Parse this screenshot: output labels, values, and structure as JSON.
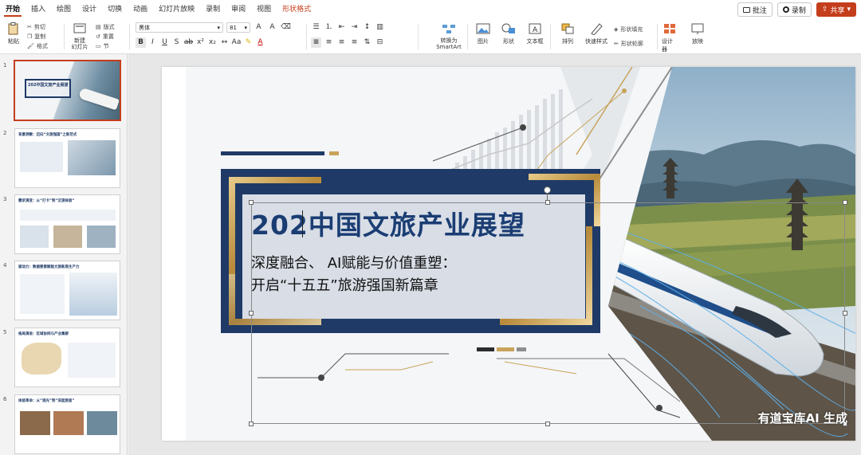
{
  "menu": {
    "tabs": [
      "开始",
      "插入",
      "绘图",
      "设计",
      "切换",
      "动画",
      "幻灯片放映",
      "录制",
      "审阅",
      "视图",
      "形状格式"
    ],
    "comment_label": "批注",
    "record_label": "录制",
    "share_label": "共享"
  },
  "ribbon": {
    "paste": "粘贴",
    "cut": "剪切",
    "copy": "复制",
    "format_painter": "格式",
    "new_slide": "新建\n幻灯片",
    "layout": "版式",
    "reset": "重置",
    "section": "节",
    "font_name": "黑体",
    "font_size": "81",
    "convert_smartart": "转换为\nSmartArt",
    "picture": "图片",
    "shapes": "形状",
    "textbox": "文本框",
    "arrange": "排列",
    "quick_styles": "快速样式",
    "shape_fill": "形状填充",
    "shape_outline": "形状轮廓",
    "design_ideas": "设计器",
    "slide_show": "放映"
  },
  "thumbnails": [
    {
      "num": "1",
      "title": "202中国文旅产业展望",
      "active": true
    },
    {
      "num": "2",
      "title": "背景洞察：迈向“文旅强国”之新范式",
      "active": false
    },
    {
      "num": "3",
      "title": "需求演变：从“打卡”到“沉浸体验”",
      "active": false
    },
    {
      "num": "4",
      "title": "驱动力：数据要素赋能文旅新质生产力",
      "active": false
    },
    {
      "num": "5",
      "title": "格局演进：区域协同与产业集群",
      "active": false
    },
    {
      "num": "6",
      "title": "体验革命：从“观光”到“深度旅居”",
      "active": false
    }
  ],
  "slide": {
    "title": "202中国文旅产业展望",
    "subtitle_line1": "深度融合、 AI赋能与价值重塑：",
    "subtitle_line2": "开启“十五五”旅游强国新篇章",
    "watermark": "有道宝库AI 生成"
  },
  "colors": {
    "accent": "#c43e1c",
    "title_blue": "#1a3d73",
    "navy": "#1f3a66",
    "gold": "#c8a35a"
  }
}
